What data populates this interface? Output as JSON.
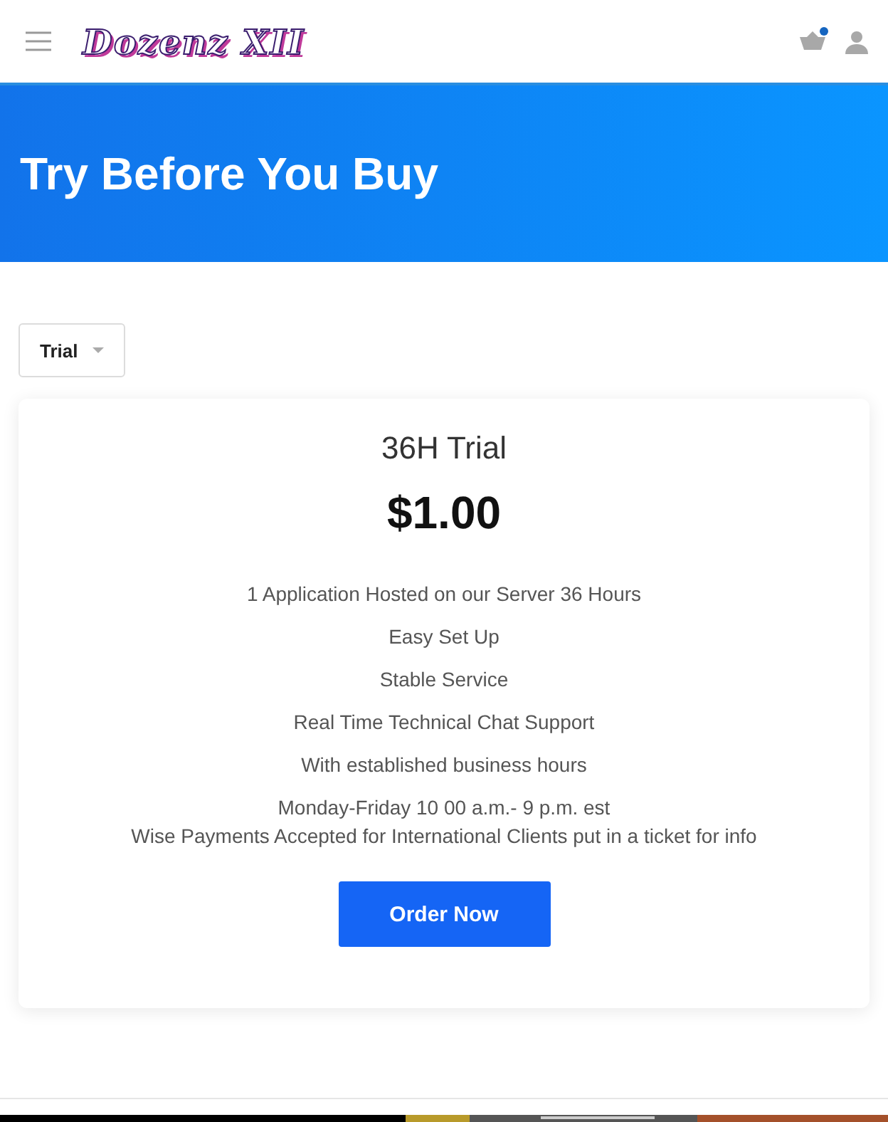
{
  "header": {
    "logo": "Dozenz XII",
    "cart_badge": true
  },
  "banner": {
    "title": "Try Before You Buy"
  },
  "filter": {
    "value": "Trial"
  },
  "plan": {
    "name": "36H Trial",
    "price": "$1.00",
    "features": [
      "1 Application Hosted on our Server 36 Hours",
      "Easy Set Up",
      "Stable Service",
      "Real Time Technical Chat Support",
      "With established business hours"
    ],
    "notes": [
      "Monday-Friday 10 00 a.m.- 9 p.m. est",
      "Wise Payments Accepted for International Clients put in a ticket for info"
    ],
    "button": "Order Now"
  }
}
